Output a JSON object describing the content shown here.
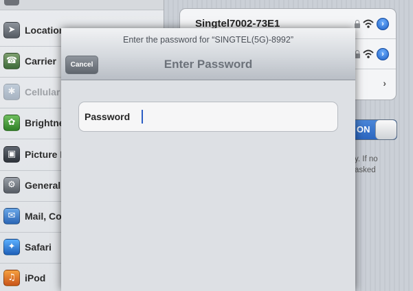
{
  "sidebar": {
    "items": [
      {
        "label": "Location",
        "icon": "location-arrow-icon"
      },
      {
        "label": "Carrier",
        "icon": "phone-icon"
      },
      {
        "label": "Cellular",
        "icon": "cellular-icon"
      },
      {
        "label": "Brightne",
        "icon": "brightness-icon"
      },
      {
        "label": "Picture F",
        "icon": "picture-frame-icon"
      },
      {
        "label": "General",
        "icon": "gear-icon"
      },
      {
        "label": "Mail, Co",
        "icon": "mail-icon"
      },
      {
        "label": "Safari",
        "icon": "compass-icon"
      },
      {
        "label": "iPod",
        "icon": "ipod-icon"
      }
    ]
  },
  "networks": {
    "items": [
      {
        "name": "Singtel7002-73E1"
      },
      {
        "name": ""
      },
      {
        "name": ""
      }
    ]
  },
  "ask_to_join": {
    "toggle_label": "ON",
    "explanation_line1": "y.  If no",
    "explanation_line2": "asked"
  },
  "dialog": {
    "prompt": "Enter the password for “SINGTEL(5G)-8992”",
    "title": "Enter Password",
    "cancel_label": "Cancel",
    "password_label": "Password",
    "password_value": ""
  },
  "colors": {
    "accent_blue": "#2b66c0",
    "caret": "#2a5cc4"
  }
}
